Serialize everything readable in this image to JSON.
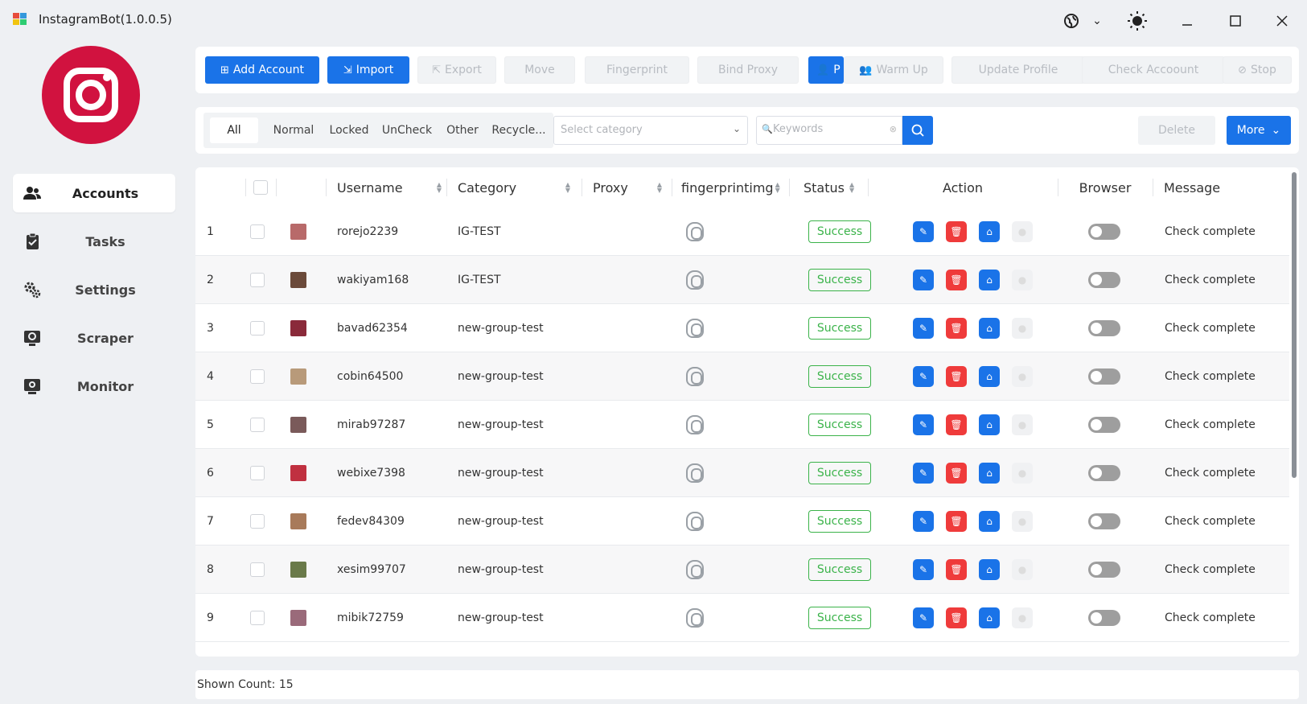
{
  "window": {
    "title": "InstagramBot(1.0.0.5)"
  },
  "sidebar": {
    "items": [
      {
        "label": "Accounts",
        "icon": "users-icon",
        "active": true
      },
      {
        "label": "Tasks",
        "icon": "clipboard-check-icon"
      },
      {
        "label": "Settings",
        "icon": "gears-icon"
      },
      {
        "label": "Scraper",
        "icon": "scraper-screen-icon"
      },
      {
        "label": "Monitor",
        "icon": "monitor-icon"
      }
    ]
  },
  "toolbar": {
    "add_account": "Add Account",
    "import": "Import",
    "export": "Export",
    "move": "Move",
    "fingerprint": "Fingerprint",
    "bind_proxy": "Bind Proxy",
    "profile": "P",
    "warm_up": "Warm Up",
    "update_profile": "Update Profile",
    "check_account": "Check Accoount",
    "stop": "Stop"
  },
  "filters": {
    "tabs": [
      "All",
      "Normal",
      "Locked",
      "UnCheck",
      "Other",
      "Recycle..."
    ],
    "category_placeholder": "Select category",
    "keywords_placeholder": "Keywords",
    "delete": "Delete",
    "more": "More"
  },
  "table": {
    "headers": {
      "username": "Username",
      "category": "Category",
      "proxy": "Proxy",
      "fingerprint": "fingerprintimg",
      "status": "Status",
      "action": "Action",
      "browser": "Browser",
      "message": "Message"
    },
    "rows": [
      {
        "num": "1",
        "username": "rorejo2239",
        "category": "IG-TEST",
        "status": "Success",
        "message": "Check complete",
        "avatar_color": "#b86a6a"
      },
      {
        "num": "2",
        "username": "wakiyam168",
        "category": "IG-TEST",
        "status": "Success",
        "message": "Check complete",
        "avatar_color": "#6b4a3a"
      },
      {
        "num": "3",
        "username": "bavad62354",
        "category": "new-group-test",
        "status": "Success",
        "message": "Check complete",
        "avatar_color": "#8a2a3a"
      },
      {
        "num": "4",
        "username": "cobin64500",
        "category": "new-group-test",
        "status": "Success",
        "message": "Check complete",
        "avatar_color": "#b89a7a"
      },
      {
        "num": "5",
        "username": "mirab97287",
        "category": "new-group-test",
        "status": "Success",
        "message": "Check complete",
        "avatar_color": "#7a5a5a"
      },
      {
        "num": "6",
        "username": "webixe7398",
        "category": "new-group-test",
        "status": "Success",
        "message": "Check complete",
        "avatar_color": "#c03040"
      },
      {
        "num": "7",
        "username": "fedev84309",
        "category": "new-group-test",
        "status": "Success",
        "message": "Check complete",
        "avatar_color": "#a87a5a"
      },
      {
        "num": "8",
        "username": "xesim99707",
        "category": "new-group-test",
        "status": "Success",
        "message": "Check complete",
        "avatar_color": "#6a7a4a"
      },
      {
        "num": "9",
        "username": "mibik72759",
        "category": "new-group-test",
        "status": "Success",
        "message": "Check complete",
        "avatar_color": "#9a6a7a"
      }
    ]
  },
  "footer": {
    "shown_count": "Shown Count: 15"
  },
  "colors": {
    "primary": "#1a73e8",
    "danger": "#ef3b3b",
    "success": "#3bb34a",
    "brand": "#d1123f"
  }
}
